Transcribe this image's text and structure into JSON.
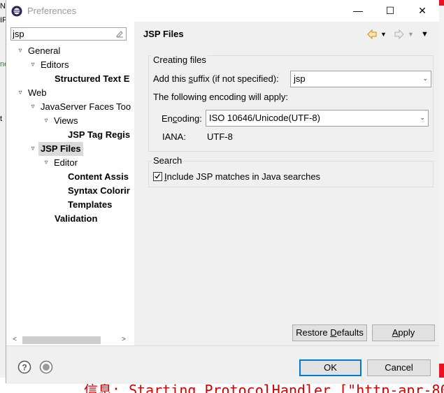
{
  "background": {
    "left_fragments": [
      "N",
      "IF",
      "ne",
      "t"
    ],
    "log_line": "信息: Starting ProtocolHandler [\"http-apr-80"
  },
  "window": {
    "title": "Preferences",
    "minimize": "—",
    "maximize": "☐",
    "close": "✕"
  },
  "filter": {
    "value": "jsp"
  },
  "tree": {
    "items": [
      {
        "label": "General",
        "arrow": "▿"
      },
      {
        "label": "Editors",
        "arrow": "▿"
      },
      {
        "label": "Structured Text E"
      },
      {
        "label": "Web",
        "arrow": "▿"
      },
      {
        "label": "JavaServer Faces Too",
        "arrow": "▿"
      },
      {
        "label": "Views",
        "arrow": "▿"
      },
      {
        "label": "JSP Tag Regis"
      },
      {
        "label": "JSP Files",
        "arrow": "▿"
      },
      {
        "label": "Editor",
        "arrow": "▿"
      },
      {
        "label": "Content Assis"
      },
      {
        "label": "Syntax Colorir"
      },
      {
        "label": "Templates"
      },
      {
        "label": "Validation"
      }
    ]
  },
  "page": {
    "title": "JSP Files",
    "creating_files": {
      "label": "Creating files",
      "suffix_label_pre": "Add this ",
      "suffix_label_u": "s",
      "suffix_label_post": "uffix (if not specified):",
      "suffix_value": "jsp",
      "encoding_intro": "The following encoding will apply:",
      "encoding_label_pre": "En",
      "encoding_label_u": "c",
      "encoding_label_post": "oding:",
      "encoding_value": "ISO 10646/Unicode(UTF-8)",
      "iana_label": "IANA:",
      "iana_value": "UTF-8"
    },
    "search": {
      "label": "Search",
      "checkbox_checked": true,
      "checkbox_label_u": "I",
      "checkbox_label_post": "nclude JSP matches in Java searches"
    },
    "restore_defaults_pre": "Restore ",
    "restore_defaults_u": "D",
    "restore_defaults_post": "efaults",
    "apply_u": "A",
    "apply_post": "pply"
  },
  "footer": {
    "ok": "OK",
    "cancel": "Cancel"
  },
  "colors": {
    "accent": "#0078d7",
    "window_bg": "#f0f0f0",
    "log_red": "#d00000"
  }
}
